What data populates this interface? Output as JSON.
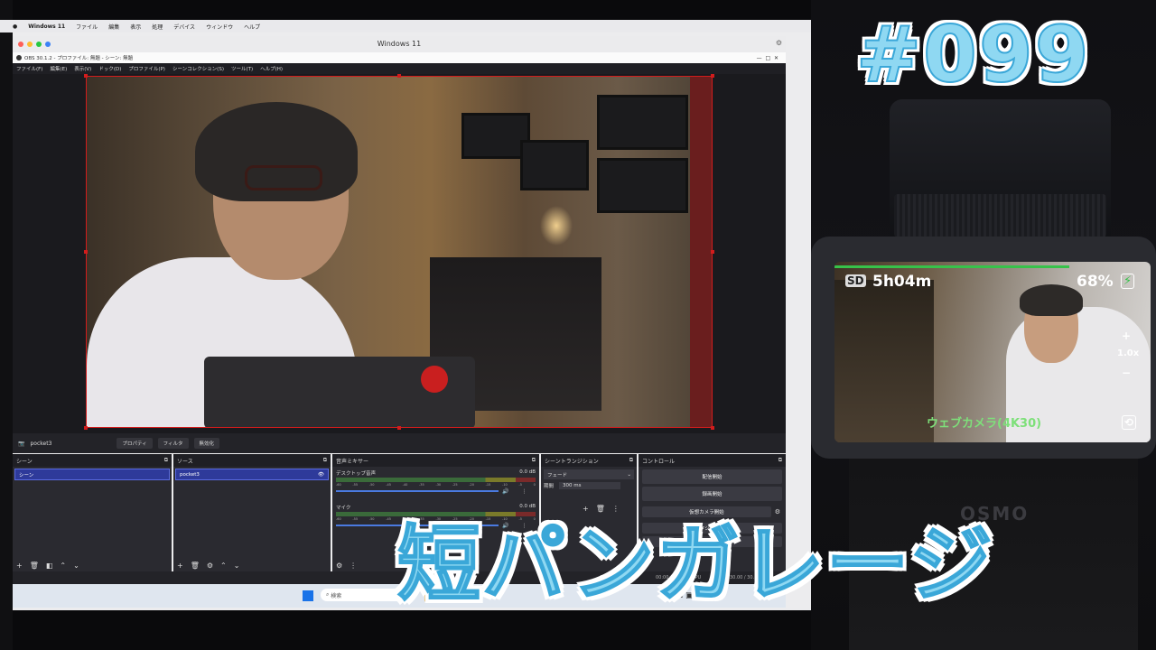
{
  "mac": {
    "menubar_items": [
      "Windows 11",
      "ファイル",
      "編集",
      "表示",
      "処理",
      "デバイス",
      "ウィンドウ",
      "ヘルプ"
    ],
    "window_title": "Windows 11"
  },
  "obs": {
    "title": "OBS 30.1.2 - プロファイル: 無題 - シーン: 無題",
    "menu": [
      "ファイル(F)",
      "編集(E)",
      "表示(V)",
      "ドック(D)",
      "プロファイル(P)",
      "シーンコレクション(S)",
      "ツール(T)",
      "ヘルプ(H)"
    ],
    "source_name": "pocket3",
    "source_buttons": [
      "プロパティ",
      "フィルタ",
      "無効化"
    ],
    "docks": {
      "scenes": {
        "title": "シーン",
        "items": [
          "シーン"
        ]
      },
      "sources": {
        "title": "ソース",
        "items": [
          "pocket3"
        ]
      },
      "mixer": {
        "title": "音声ミキサー",
        "channels": [
          {
            "name": "デスクトップ音声",
            "level": "0.0 dB"
          },
          {
            "name": "マイク",
            "level": "0.0 dB"
          }
        ],
        "ticks": [
          "-60",
          "-55",
          "-50",
          "-45",
          "-40",
          "-35",
          "-30",
          "-25",
          "-20",
          "-15",
          "-10",
          "-5",
          "0"
        ]
      },
      "transitions": {
        "title": "シーントランジション",
        "selected": "フェード",
        "duration_label": "期間",
        "duration_value": "300 ms"
      },
      "controls": {
        "title": "コントロール",
        "buttons": [
          "配信開始",
          "録画開始",
          "仮想カメラ開始",
          "スタジオモード",
          "設定"
        ]
      }
    },
    "status": {
      "time1": "00:00:00",
      "time2": "00:00:00",
      "cpu": "CPU",
      "fps": "30.00 / 30.00 FPS"
    }
  },
  "taskbar": {
    "search_placeholder": "検索"
  },
  "camera": {
    "brand": "OSMO",
    "storage": "SD",
    "remaining": "5h04m",
    "battery": "68%",
    "zoom": "1.0x",
    "mode": "ウェブカメラ(4K30)"
  },
  "overlay": {
    "episode": "#099",
    "title": "短パンガレージ"
  },
  "colors": {
    "accent_blue": "#8fd8f2",
    "selection_red": "#d21c1c",
    "list_selected": "#2e3a9a"
  }
}
